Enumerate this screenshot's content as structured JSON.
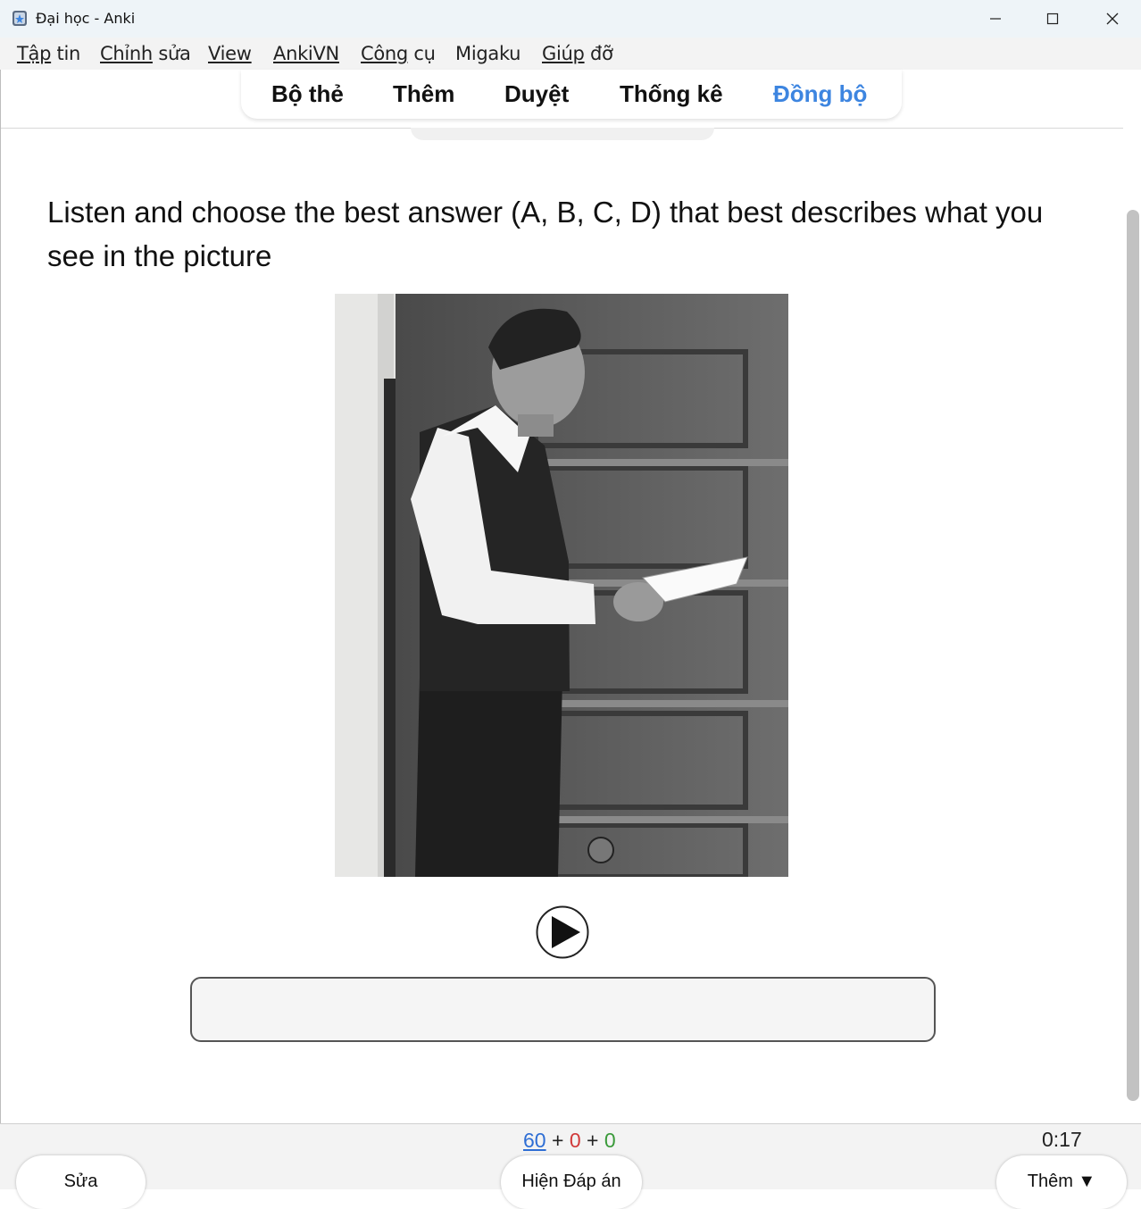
{
  "window": {
    "title": "Đại học - Anki",
    "controls": [
      "minimize",
      "maximize",
      "close"
    ]
  },
  "menu": [
    {
      "key": "Tập",
      "rest": " tin"
    },
    {
      "key": "Chỉnh",
      "rest": " sửa"
    },
    {
      "key": "View",
      "rest": ""
    },
    {
      "key": "AnkiVN",
      "rest": ""
    },
    {
      "key": "Công",
      "rest": " cụ"
    },
    {
      "key": "Migaku",
      "rest": ""
    },
    {
      "key": "Giúp",
      "rest": " đỡ"
    }
  ],
  "toolbar": {
    "decks": "Bộ thẻ",
    "add": "Thêm",
    "browse": "Duyệt",
    "stats": "Thống kê",
    "sync": "Đồng bộ",
    "sync_color": "#3d85e0"
  },
  "card": {
    "question": "Listen and choose the best answer (A, B, C, D) that best describes what you see in the picture",
    "image_icon": "photo-man-reading-letter",
    "answer_value": ""
  },
  "bottom": {
    "count_new": "60",
    "count_learn": "0",
    "count_review": "0",
    "plus": "+",
    "timer": "0:17",
    "edit_label": "Sửa",
    "show_answer_label": "Hiện Đáp án",
    "more_label": "Thêm ▼",
    "colors": {
      "new": "#2e6ed4",
      "learn": "#d13a3a",
      "review": "#3a9a3a"
    }
  }
}
